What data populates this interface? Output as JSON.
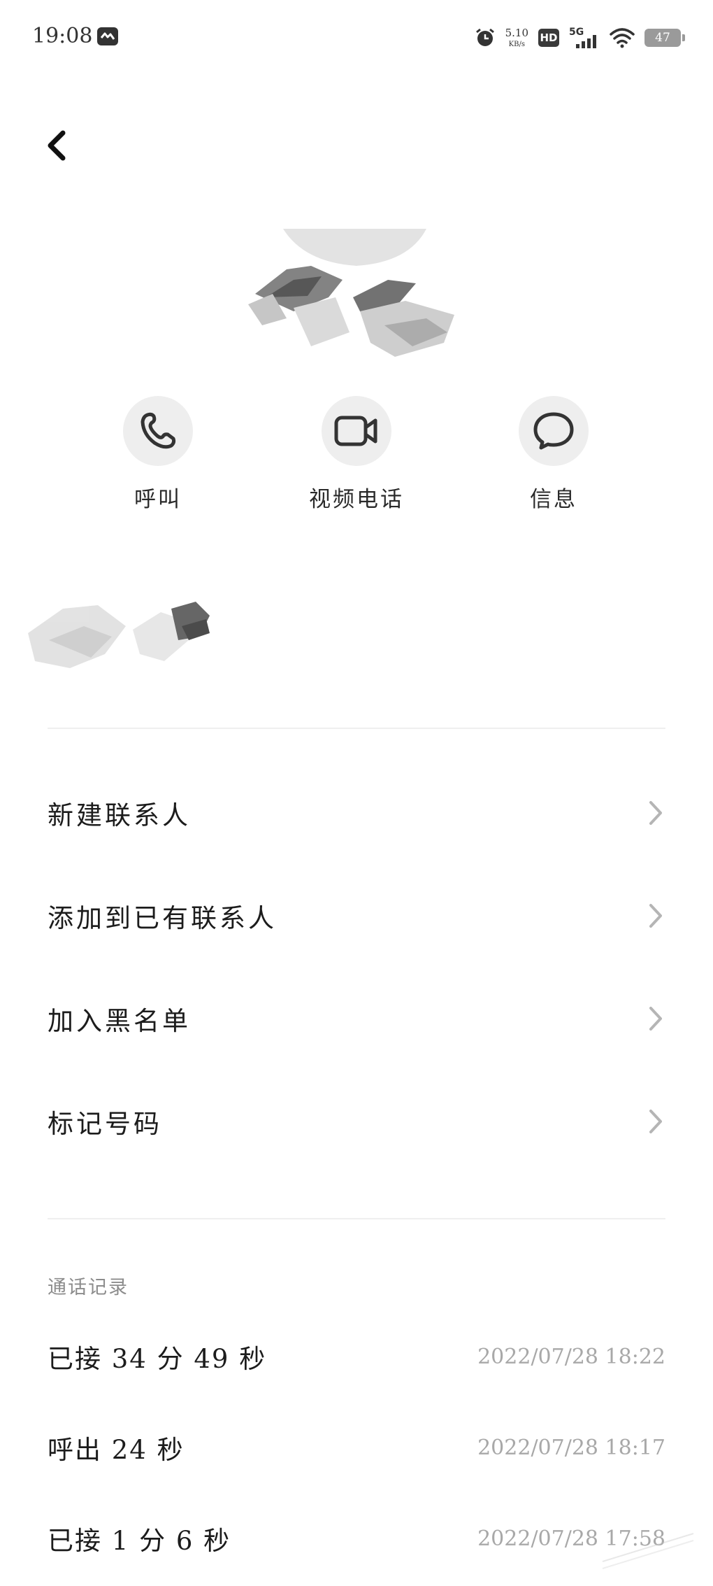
{
  "status_bar": {
    "time": "19:08",
    "net_speed_value": "5.10",
    "net_speed_unit": "KB/s",
    "hd_label": "HD",
    "network_label": "5G",
    "battery": "47",
    "icons": [
      "app-notification-icon",
      "alarm-icon",
      "hd-icon",
      "signal-5g-icon",
      "wifi-icon",
      "battery-icon"
    ]
  },
  "actions": [
    {
      "label": "呼叫",
      "icon": "phone-icon"
    },
    {
      "label": "视频电话",
      "icon": "video-camera-icon"
    },
    {
      "label": "信息",
      "icon": "message-bubble-icon"
    }
  ],
  "menu": [
    {
      "label": "新建联系人"
    },
    {
      "label": "添加到已有联系人"
    },
    {
      "label": "加入黑名单"
    },
    {
      "label": "标记号码"
    }
  ],
  "call_log": {
    "title": "通话记录",
    "entries": [
      {
        "desc": "已接 34 分 49 秒",
        "time": "2022/07/28 18:22"
      },
      {
        "desc": "呼出 24 秒",
        "time": "2022/07/28 18:17"
      },
      {
        "desc": "已接 1 分 6 秒",
        "time": "2022/07/28 17:58"
      }
    ]
  }
}
